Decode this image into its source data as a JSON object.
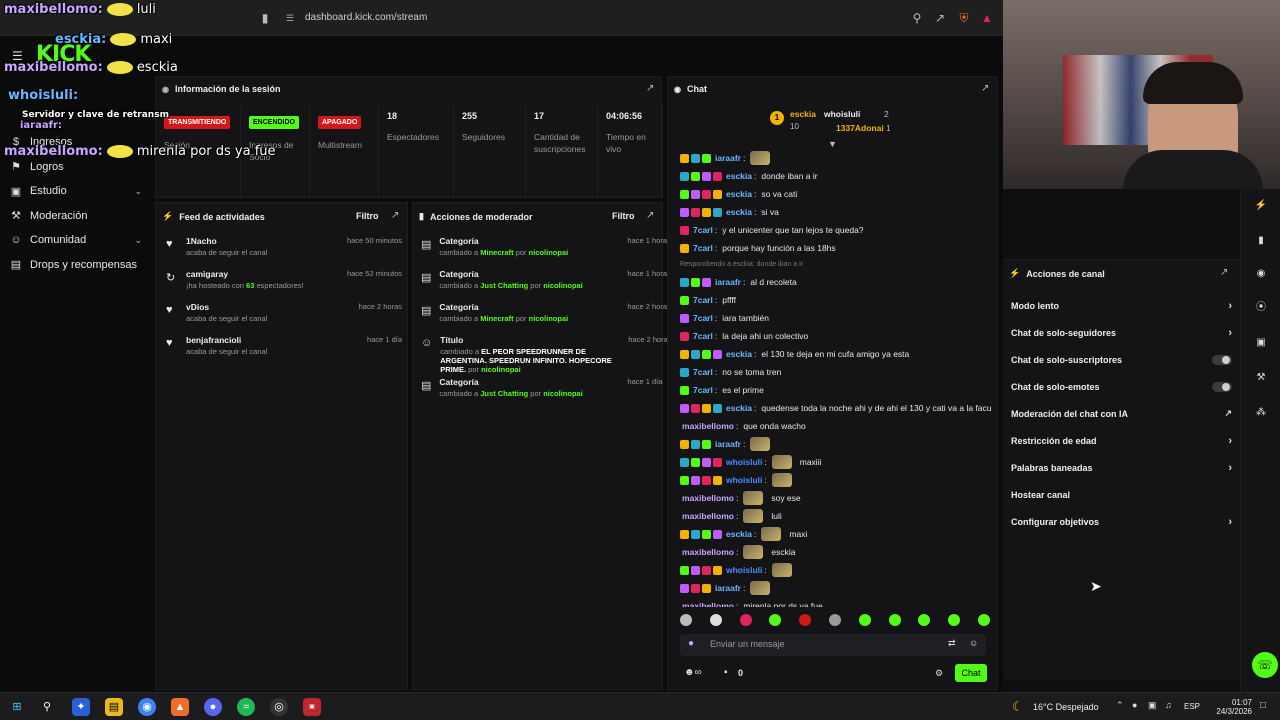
{
  "browser": {
    "url": "dashboard.kick.com/stream"
  },
  "overlay_chat": [
    {
      "name": "maxibellomo:",
      "text": "luli"
    },
    {
      "name": "esckia:",
      "text": "maxi"
    },
    {
      "name": "maxibellomo:",
      "text": "esckia"
    },
    {
      "name": "whoisluli:",
      "text": ""
    },
    {
      "name": "Servidor y clave de retransm",
      "text": ""
    },
    {
      "name": "iaraafr:",
      "text": ""
    },
    {
      "name": "maxibellomo:",
      "text": "mirenla por ds ya fue"
    }
  ],
  "brand": {
    "logo": "KICK"
  },
  "nav": {
    "items": [
      {
        "label": "Ingresos",
        "icon": "dollar-icon",
        "chevron": false
      },
      {
        "label": "Logros",
        "icon": "trophy-icon",
        "chevron": false
      },
      {
        "label": "Estudio",
        "icon": "monitor-icon",
        "chevron": true
      },
      {
        "label": "Moderación",
        "icon": "wrench-icon",
        "chevron": false
      },
      {
        "label": "Comunidad",
        "icon": "users-icon",
        "chevron": true
      },
      {
        "label": "Drops y recompensas",
        "icon": "gift-icon",
        "chevron": false
      }
    ]
  },
  "session": {
    "title": "Información de la sesión",
    "cards": [
      {
        "badge": "TRANSMITIENDO",
        "badge_color": "#d4171a",
        "label": "Sesión"
      },
      {
        "badge": "ENCENDIDO",
        "badge_color": "#53fc18",
        "label": "Ingresos de Socio"
      },
      {
        "badge": "APAGADO",
        "badge_color": "#d4171a",
        "label": "Multistream"
      },
      {
        "value": "18",
        "label": "Espectadores"
      },
      {
        "value": "255",
        "label": "Seguidores"
      },
      {
        "value": "17",
        "label": "Cantidad de suscripciones"
      },
      {
        "value": "04:06:56",
        "label": "Tiempo en vivo"
      }
    ]
  },
  "feed": {
    "title": "Feed de actividades",
    "filter": "Filtro",
    "items": [
      {
        "name": "1Nacho",
        "sub": "acaba de seguir el canal",
        "time": "hace 50 minutos",
        "icon": "heart-icon"
      },
      {
        "name": "camigaray",
        "sub_pre": "¡ha hosteado con ",
        "sub_num": "63",
        "sub_post": " espectadores!",
        "time": "hace 52 minutos",
        "icon": "host-icon"
      },
      {
        "name": "vDios",
        "sub": "acaba de seguir el canal",
        "time": "hace 2 horas",
        "icon": "heart-icon"
      },
      {
        "name": "benjafrancioli",
        "sub": "acaba de seguir el canal",
        "time": "hace 1 día",
        "icon": "heart-icon"
      }
    ]
  },
  "modactions": {
    "title": "Acciones de moderador",
    "filter": "Filtro",
    "items": [
      {
        "name": "Categoría",
        "pre": "cambiado a ",
        "val": "Minecraft",
        "mid": " por ",
        "by": "nicolinopai",
        "time": "hace 1 hora"
      },
      {
        "name": "Categoría",
        "pre": "cambiado a ",
        "val": "Just Chatting",
        "mid": " por ",
        "by": "nicolinopai",
        "time": "hace 1 hora"
      },
      {
        "name": "Categoría",
        "pre": "cambiado a ",
        "val": "Minecraft",
        "mid": " por ",
        "by": "nicolinopai",
        "time": "hace 2 horas"
      },
      {
        "name": "Título",
        "pre": "cambiado a ",
        "val": "EL PEOR SPEEDRUNNER DE ARGENTINA. SPEEDRUN INFINITO. HOPECORE PRIME.",
        "mid": " por ",
        "by": "nicolinopai",
        "time": "hace 2 horas"
      },
      {
        "name": "Categoría",
        "pre": "cambiado a ",
        "val": "Just Chatting",
        "mid": " por ",
        "by": "nicolinopai",
        "time": "hace 1 día"
      }
    ]
  },
  "chat": {
    "title": "Chat",
    "pinned": {
      "left_name": "esckia",
      "left_count": "10",
      "right1": "whoisluli",
      "right1_n": "2",
      "right2": "1337Adonai",
      "right2_n": "1"
    },
    "reply_note": "Respondiendo a esckia: donde iban a ir",
    "messages": [
      {
        "user": "iaraafr",
        "color": "#6ab7ff",
        "text": ""
      },
      {
        "user": "esckia",
        "color": "#6ab7ff",
        "text": "donde iban a ir"
      },
      {
        "user": "esckia",
        "color": "#6ab7ff",
        "text": "so va cati"
      },
      {
        "user": "esckia",
        "color": "#6ab7ff",
        "text": "si va"
      },
      {
        "user": "7carl",
        "color": "#6ab7ff",
        "text": "y el unicenter que tan lejos te queda?"
      },
      {
        "user": "7carl",
        "color": "#6ab7ff",
        "text": "porque hay función a las 18hs"
      },
      {
        "user": "iaraafr",
        "color": "#6ab7ff",
        "text": "al d recoleta"
      },
      {
        "user": "7carl",
        "color": "#6ab7ff",
        "text": "pffff"
      },
      {
        "user": "7carl",
        "color": "#6ab7ff",
        "text": "iara también"
      },
      {
        "user": "7carl",
        "color": "#6ab7ff",
        "text": "la deja ahi un colectivo"
      },
      {
        "user": "esckia",
        "color": "#6ab7ff",
        "text": "el 130 te deja en mi cufa amigo ya esta"
      },
      {
        "user": "7carl",
        "color": "#6ab7ff",
        "text": "no se toma tren"
      },
      {
        "user": "7carl",
        "color": "#6ab7ff",
        "text": "es el prime"
      },
      {
        "user": "esckia",
        "color": "#6ab7ff",
        "text": "quedense toda la noche ahi y de ahi el 130 y cati va a la facu"
      },
      {
        "user": "maxibellomo",
        "color": "#c7a7ff",
        "text": "que onda wacho"
      },
      {
        "user": "iaraafr",
        "color": "#6ab7ff",
        "text": ""
      },
      {
        "user": "whoisluli",
        "color": "#4a8cff",
        "text": "maxiii"
      },
      {
        "user": "whoisluli",
        "color": "#4a8cff",
        "text": ""
      },
      {
        "user": "maxibellomo",
        "color": "#c7a7ff",
        "text": "soy ese"
      },
      {
        "user": "maxibellomo",
        "color": "#c7a7ff",
        "text": "luli"
      },
      {
        "user": "esckia",
        "color": "#6ab7ff",
        "text": "maxi"
      },
      {
        "user": "maxibellomo",
        "color": "#c7a7ff",
        "text": "esckia"
      },
      {
        "user": "whoisluli",
        "color": "#4a8cff",
        "text": ""
      },
      {
        "user": "iaraafr",
        "color": "#6ab7ff",
        "text": ""
      },
      {
        "user": "maxibellomo",
        "color": "#c7a7ff",
        "text": "mirenla por ds ya fue"
      }
    ],
    "input_placeholder": "Enviar un mensaje",
    "count": "0",
    "send": "Chat"
  },
  "channel_actions": {
    "title": "Acciones de canal",
    "items": [
      {
        "label": "Modo lento",
        "type": "chevron"
      },
      {
        "label": "Chat de solo-seguidores",
        "type": "chevron"
      },
      {
        "label": "Chat de solo-suscriptores",
        "type": "toggle"
      },
      {
        "label": "Chat de solo-emotes",
        "type": "toggle"
      },
      {
        "label": "Moderación del chat con IA",
        "type": "external"
      },
      {
        "label": "Restricción de edad",
        "type": "chevron"
      },
      {
        "label": "Palabras baneadas",
        "type": "chevron"
      },
      {
        "label": "Hostear canal",
        "type": "none"
      },
      {
        "label": "Configurar objetivos",
        "type": "chevron"
      }
    ]
  },
  "taskbar": {
    "weather": "16°C  Despejado",
    "lang": "ESP",
    "time": "01:07",
    "date": "24/3/2026"
  },
  "colors": {
    "accent": "#53fc18",
    "live": "#d4171a"
  }
}
